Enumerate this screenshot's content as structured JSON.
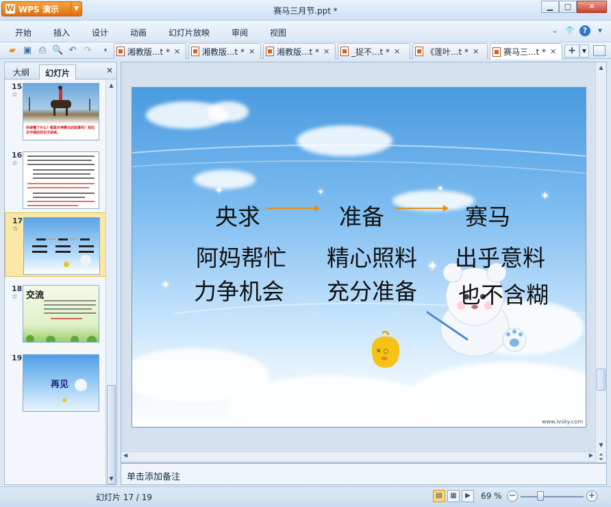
{
  "window": {
    "app_name": "WPS 演示",
    "app_logo": "W",
    "title": "赛马三月节.ppt *",
    "controls": {
      "minimize": "▁",
      "maximize": "□",
      "close": "✕"
    }
  },
  "menu": {
    "items": [
      "开始",
      "插入",
      "设计",
      "动画",
      "幻灯片放映",
      "审阅",
      "视图"
    ]
  },
  "toolbar": {
    "icons": [
      "open-icon",
      "save-icon",
      "print-icon",
      "print-preview-icon",
      "undo-icon",
      "redo-icon",
      "customize-icon"
    ]
  },
  "doc_tabs": [
    {
      "label": "湘教版...t *",
      "active": false
    },
    {
      "label": "湘教版...t *",
      "active": false
    },
    {
      "label": "湘教版...t *",
      "active": false
    },
    {
      "label": "_捉不...t *",
      "active": false
    },
    {
      "label": "《莲叶...t *",
      "active": false
    },
    {
      "label": "赛马三...t *",
      "active": true
    }
  ],
  "left_pane": {
    "tabs": [
      "大纲",
      "幻灯片"
    ],
    "active_tab": "幻灯片",
    "close": "✕",
    "thumbnails": [
      {
        "number": "15",
        "star": "☆",
        "caption": "你读懂了什么？都是天神赛马的故事吗？找出文中相应的句子读读。"
      },
      {
        "number": "16",
        "star": "☆",
        "caption": ""
      },
      {
        "number": "17",
        "star": "☆",
        "selected": true
      },
      {
        "number": "18",
        "star": "☆",
        "title": "交流"
      },
      {
        "number": "19",
        "star": "",
        "title": "再见"
      }
    ]
  },
  "slide": {
    "row1": [
      "央求",
      "准备",
      "赛马"
    ],
    "row2": [
      "阿妈帮忙",
      "精心照料",
      "出乎意料"
    ],
    "row3": [
      "力争机会",
      "充分准备",
      "也不含糊"
    ],
    "watermark": "www.ivsky.com",
    "arrow_color": "#e88c16"
  },
  "notes": {
    "placeholder": "单击添加备注"
  },
  "status": {
    "slide_info": "幻灯片 17 / 19",
    "zoom": "69 %",
    "zoom_minus": "−",
    "zoom_plus": "+"
  }
}
